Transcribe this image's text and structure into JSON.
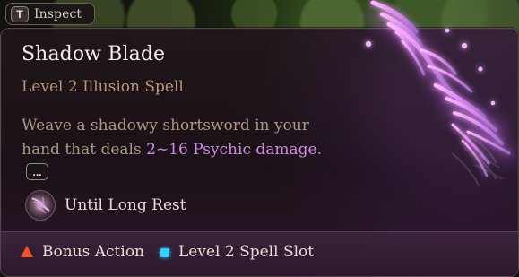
{
  "inspect": {
    "key": "T",
    "label": "Inspect"
  },
  "spell": {
    "title": "Shadow Blade",
    "subtitle": "Level 2 Illusion Spell",
    "description_prefix": "Weave a shadowy shortsword in your hand that deals ",
    "damage": "2~16 Psychic damage",
    "description_suffix": ".",
    "more_label": "...",
    "duration": "Until Long Rest"
  },
  "footer": {
    "action_cost": "Bonus Action",
    "spell_slot": "Level 2 Spell Slot"
  },
  "icons": {
    "inspect_key": "keyboard-key-icon",
    "duration": "shadow-blade-icon",
    "action": "bonus-action-icon",
    "slot": "spell-slot-icon",
    "more": "more-icon"
  },
  "colors": {
    "title": "#f1ece6",
    "subtitle": "#b69678",
    "body": "#ab9986",
    "damage": "#d18ce2",
    "action": "#ef5423",
    "slot": "#2ed4ff"
  }
}
